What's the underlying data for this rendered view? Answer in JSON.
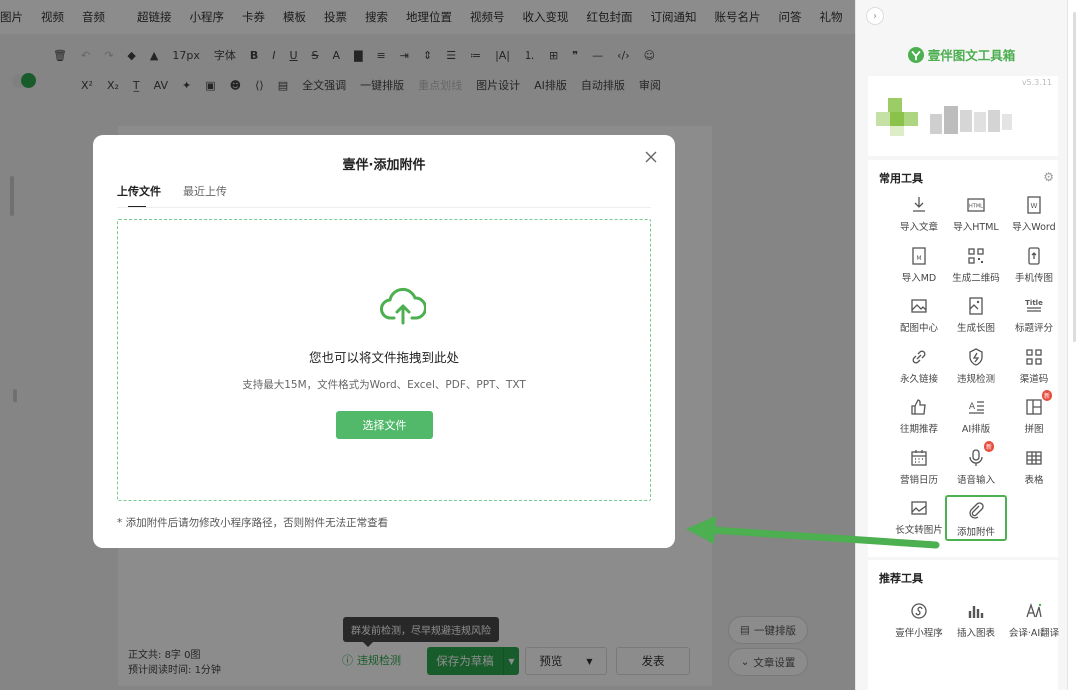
{
  "menu": [
    "图片",
    "视频",
    "音频",
    "超链接",
    "小程序",
    "卡券",
    "模板",
    "投票",
    "搜索",
    "地理位置",
    "视频号",
    "收入变现",
    "红包封面",
    "订阅通知",
    "账号名片",
    "问答",
    "礼物"
  ],
  "toolbar": {
    "font_size": "17px",
    "font_spacing": "字体",
    "row1": [
      "B",
      "I",
      "U",
      "S",
      "A"
    ],
    "superscript": "X²",
    "subscript": "X₂",
    "full_emphasis": "全文强调",
    "one_click_layout": "一键排版",
    "key_underline": "重点划线",
    "image_design": "图片设计",
    "ai_layout": "AI排版",
    "auto_layout": "自动排版",
    "review": "审阅"
  },
  "status": {
    "word_count_label": "正文共:",
    "word_count_value": "8字 0图",
    "read_time_label": "预计阅读时间:",
    "read_time_value": "1分钟",
    "tooltip": "群发前检测，尽早规避违规风险",
    "violation_check": "违规检测",
    "save_draft": "保存为草稿",
    "preview": "预览",
    "publish": "发表",
    "one_click": "一键排版",
    "article_settings": "文章设置"
  },
  "modal": {
    "title": "壹伴·添加附件",
    "tabs": [
      "上传文件",
      "最近上传"
    ],
    "drop_title": "您也可以将文件拖拽到此处",
    "drop_hint": "支持最大15M，文件格式为Word、Excel、PDF、PPT、TXT",
    "choose_button": "选择文件",
    "note": "* 添加附件后请勿修改小程序路径，否则附件无法正常查看"
  },
  "panel": {
    "brand": "壹伴图文工具箱",
    "version": "v5.3.11",
    "common_title": "常用工具",
    "common_tools": [
      {
        "label": "导入文章",
        "icon": "import-article-icon"
      },
      {
        "label": "导入HTML",
        "icon": "html-icon"
      },
      {
        "label": "导入Word",
        "icon": "word-icon"
      },
      {
        "label": "导入MD",
        "icon": "markdown-icon"
      },
      {
        "label": "生成二维码",
        "icon": "qrcode-icon"
      },
      {
        "label": "手机传图",
        "icon": "phone-upload-icon"
      },
      {
        "label": "配图中心",
        "icon": "image-center-icon"
      },
      {
        "label": "生成长图",
        "icon": "long-image-icon"
      },
      {
        "label": "标题评分",
        "icon": "title-score-icon"
      },
      {
        "label": "永久链接",
        "icon": "link-icon"
      },
      {
        "label": "违规检测",
        "icon": "shield-icon"
      },
      {
        "label": "渠道码",
        "icon": "channel-code-icon"
      },
      {
        "label": "往期推荐",
        "icon": "thumbs-up-icon"
      },
      {
        "label": "AI排版",
        "icon": "ai-layout-icon"
      },
      {
        "label": "拼图",
        "icon": "collage-icon"
      },
      {
        "label": "营销日历",
        "icon": "calendar-icon"
      },
      {
        "label": "语音输入",
        "icon": "microphone-icon"
      },
      {
        "label": "表格",
        "icon": "table-icon"
      },
      {
        "label": "长文转图片",
        "icon": "text-to-image-icon"
      },
      {
        "label": "添加附件",
        "icon": "paperclip-icon"
      }
    ],
    "new_badge": "新",
    "recommend_title": "推荐工具",
    "recommend_tools": [
      {
        "label": "壹伴小程序",
        "icon": "miniprogram-icon"
      },
      {
        "label": "插入图表",
        "icon": "chart-icon"
      },
      {
        "label": "会译·AI翻译",
        "icon": "translate-icon"
      }
    ]
  },
  "colors": {
    "accent": "#4caf50",
    "button_green": "#52b96a",
    "badge_red": "#e74c3c"
  }
}
